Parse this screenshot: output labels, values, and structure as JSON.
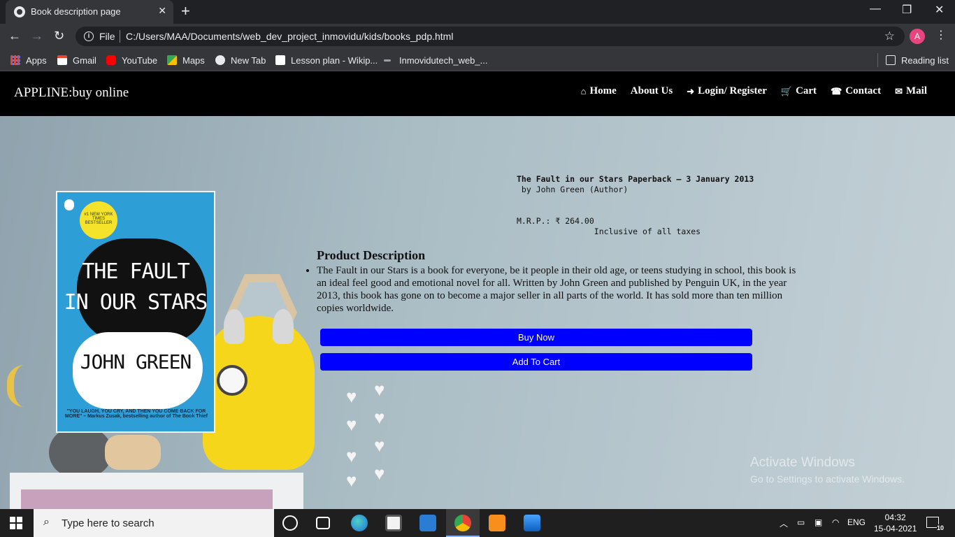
{
  "browser": {
    "tab_title": "Book description page",
    "tab_close": "✕",
    "new_tab": "+",
    "window_controls": {
      "minimize": "—",
      "restore": "❐",
      "close": "✕"
    },
    "nav": {
      "back": "←",
      "forward": "→",
      "reload": "↻"
    },
    "omnibox": {
      "scheme_label": "File",
      "url": "C:/Users/MAA/Documents/web_dev_project_inmovidu/kids/books_pdp.html",
      "info_icon": "i",
      "star": "☆"
    },
    "profile_initial": "A",
    "menu": "⋮",
    "bookmarks": [
      {
        "label": "Apps",
        "icon": "apps-grid-icon",
        "color": "#e8453c"
      },
      {
        "label": "Gmail",
        "icon": "gmail-icon",
        "color": "#ea4335"
      },
      {
        "label": "YouTube",
        "icon": "youtube-icon",
        "color": "#ff0000"
      },
      {
        "label": "Maps",
        "icon": "maps-icon",
        "color": "#34a853"
      },
      {
        "label": "New Tab",
        "icon": "globe-icon",
        "color": "#e8eaed"
      },
      {
        "label": "Lesson plan - Wikip...",
        "icon": "wikipedia-icon",
        "color": "#ffffff"
      },
      {
        "label": "Inmovidutech_web_...",
        "icon": "page-icon",
        "color": "#9aa0a6"
      }
    ],
    "reading_list": "Reading list"
  },
  "site": {
    "brand": "APPLINE:buy online",
    "nav": [
      {
        "label": "Home",
        "icon": "home-icon",
        "glyph": "⌂"
      },
      {
        "label": "About Us",
        "icon": "",
        "glyph": ""
      },
      {
        "label": "Login/ Register",
        "icon": "sign-in-icon",
        "glyph": "➜"
      },
      {
        "label": "Cart",
        "icon": "cart-icon",
        "glyph": "🛒"
      },
      {
        "label": "Contact",
        "icon": "phone-icon",
        "glyph": "☎"
      },
      {
        "label": "Mail",
        "icon": "envelope-icon",
        "glyph": "✉"
      }
    ]
  },
  "product": {
    "cover": {
      "title_line1": "THE FAULT",
      "title_line2": "IN OUR STARS",
      "author": "JOHN GREEN",
      "sticker": "#1 NEW YORK TIMES BESTSELLER",
      "quote": "\"YOU LAUGH, YOU CRY, AND THEN YOU COME BACK FOR MORE\" – Markus Zusak, bestselling author of The Book Thief"
    },
    "title": "The Fault in our Stars Paperback – 3 January 2013",
    "byline": " by John Green (Author)",
    "mrp": "M.R.P.: ₹ 264.00",
    "tax_note": "                Inclusive of all taxes",
    "description_heading": "Product Description",
    "description": "The Fault in our Stars is a book for everyone, be it people in their old age, or teens studying in school, this book is an ideal feel good and emotional novel for all. Written by John Green and published by Penguin UK, in the year 2013, this book has gone on to become a major seller in all parts of the world. It has sold more than ten million copies worldwide.",
    "buy_now": "Buy Now",
    "add_to_cart": "Add To Cart"
  },
  "watermark": {
    "line1": "Activate Windows",
    "line2": "Go to Settings to activate Windows."
  },
  "taskbar": {
    "search_placeholder": "Type here to search",
    "language": "ENG",
    "time": "04:32",
    "date": "15-04-2021",
    "notifications": "10"
  },
  "colors": {
    "button": "#0000ff",
    "navbar": "#000000",
    "chrome_dark": "#202124",
    "chrome_toolbar": "#35363a"
  }
}
